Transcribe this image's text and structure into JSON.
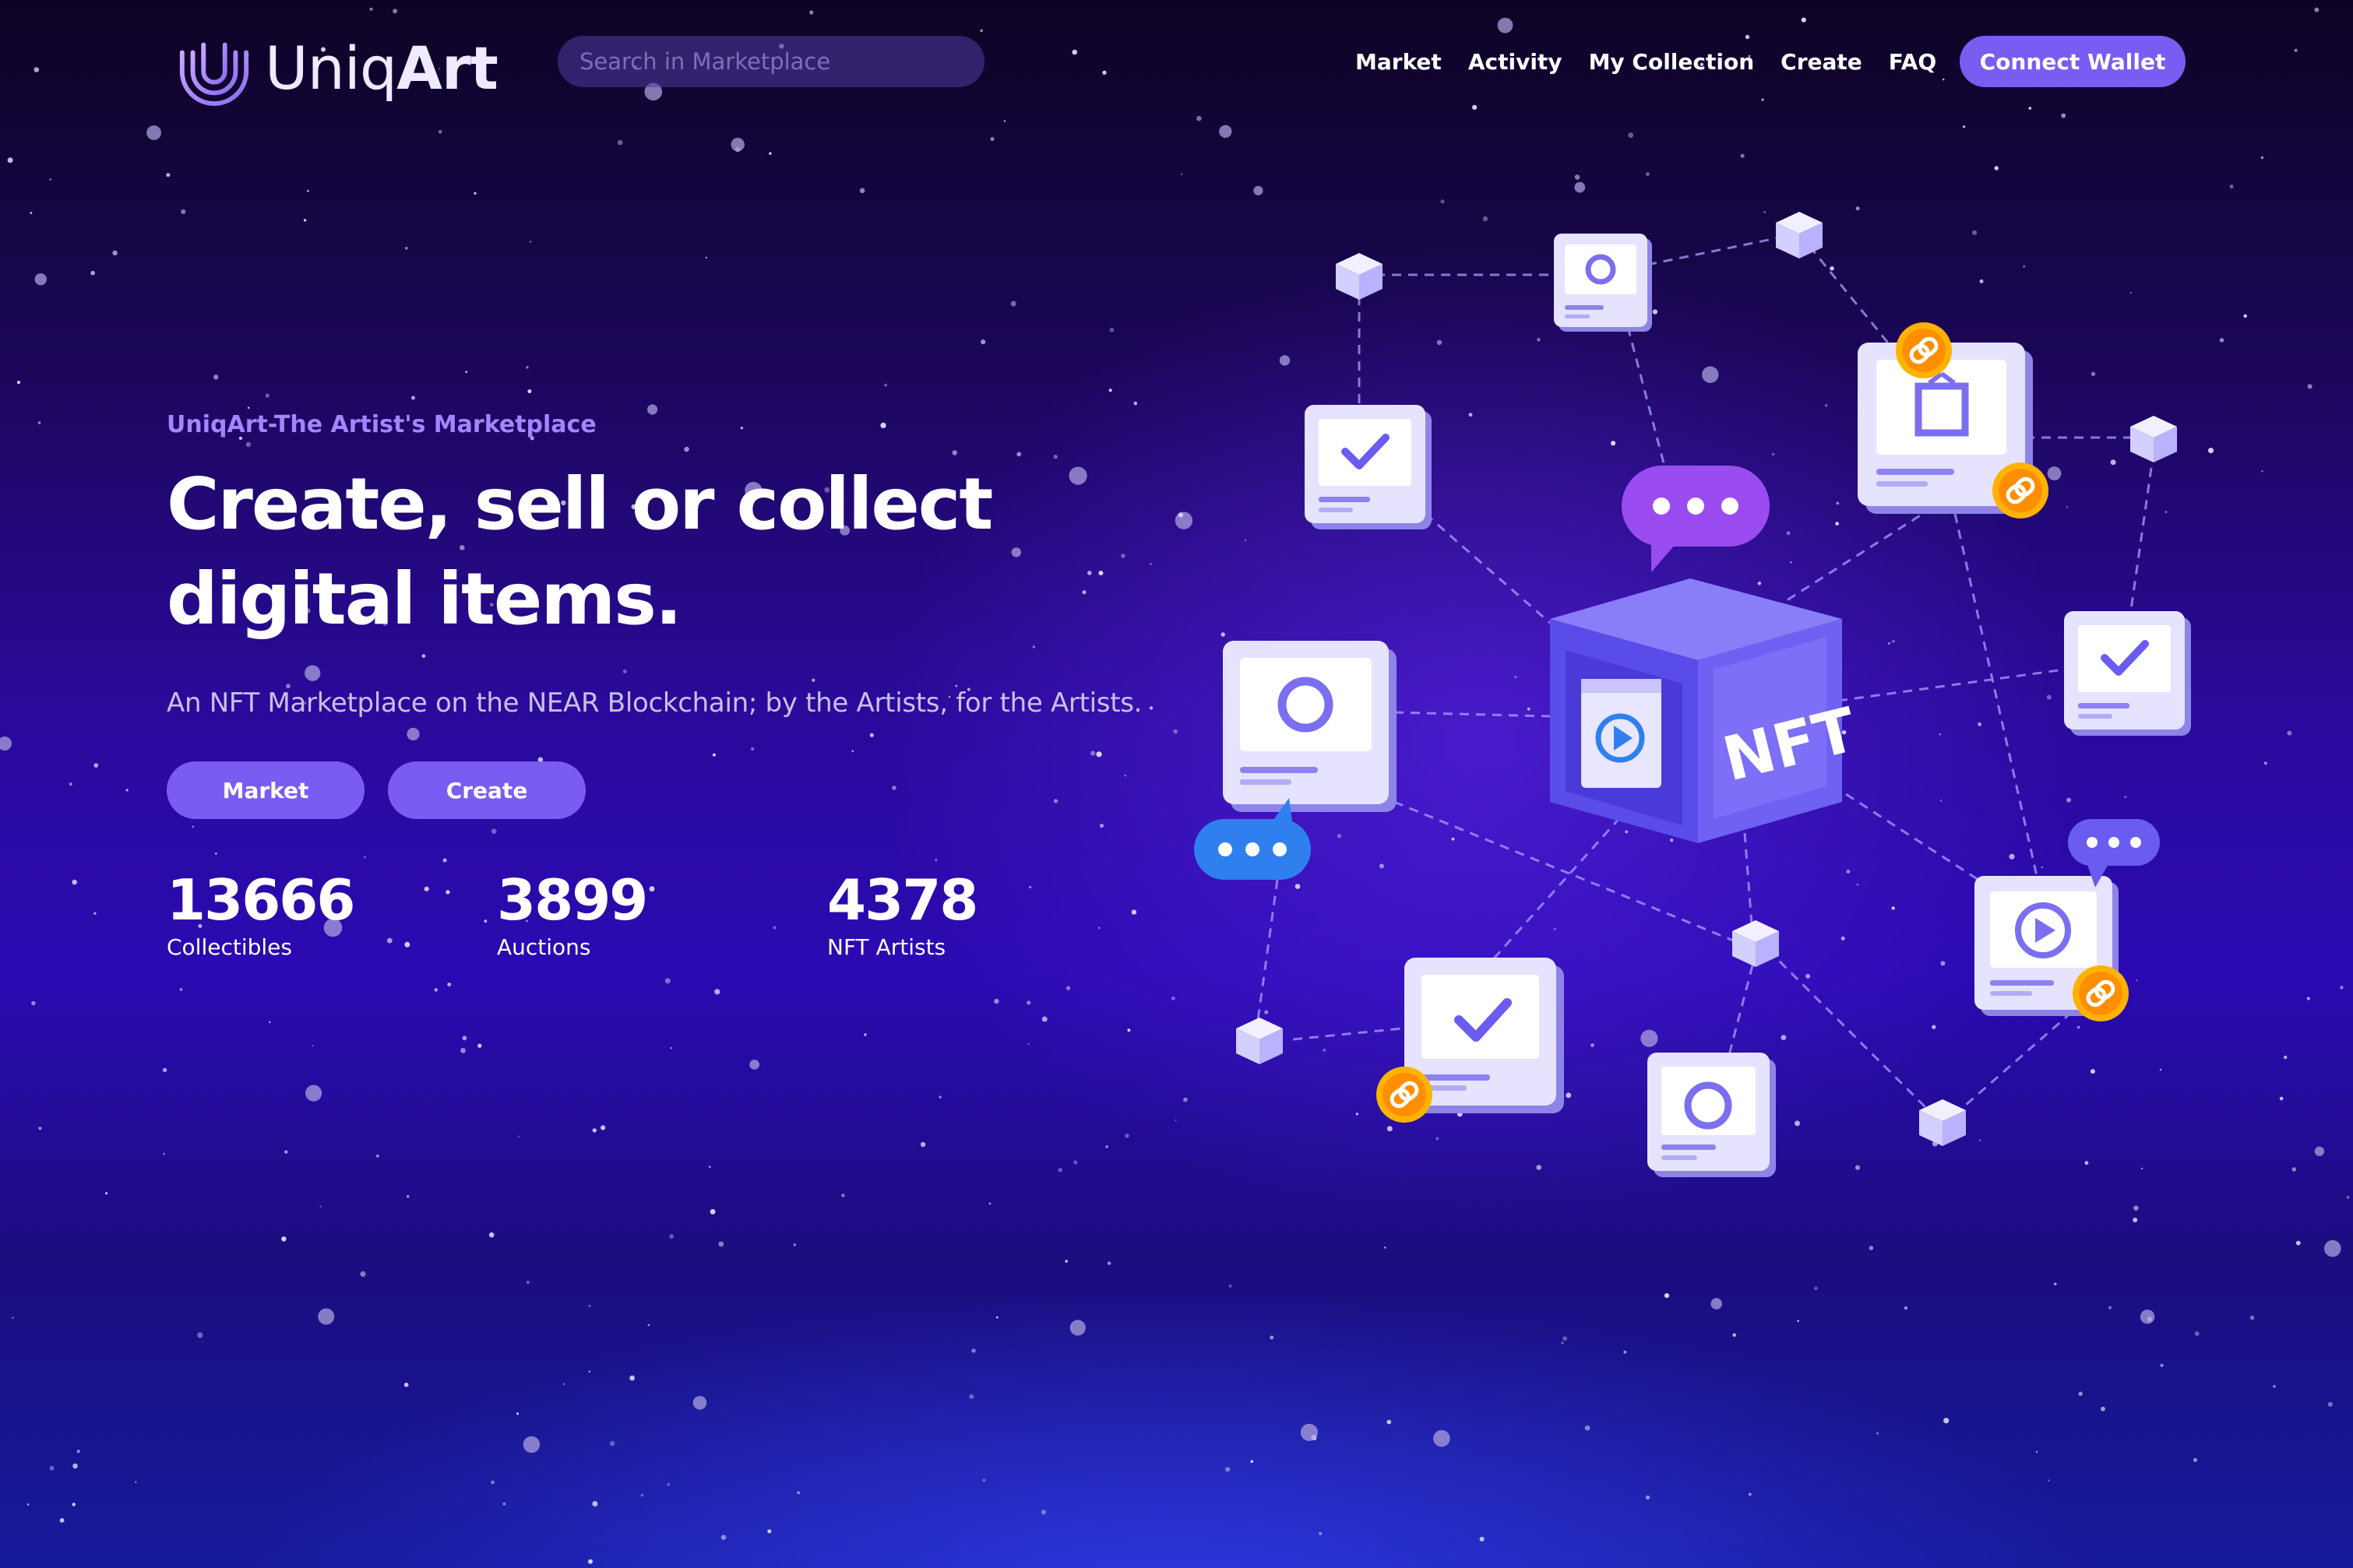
{
  "header": {
    "logo_part1": "Uniq",
    "logo_part2": "Art",
    "search_placeholder": "Search in Marketplace",
    "nav": [
      "Market",
      "Activity",
      "My Collection",
      "Create",
      "FAQ"
    ],
    "connect_label": "Connect Wallet"
  },
  "hero": {
    "eyebrow": "UniqArt-The Artist's Marketplace",
    "headline_line1": "Create, sell or collect",
    "headline_line2": "digital items.",
    "subtitle": "An NFT Marketplace on the NEAR Blockchain; by the Artists, for the Artists.",
    "buttons": {
      "market": "Market",
      "create": "Create"
    },
    "stats": [
      {
        "value": "13666",
        "label": "Collectibles"
      },
      {
        "value": "3899",
        "label": "Auctions"
      },
      {
        "value": "4378",
        "label": "NFT Artists"
      }
    ]
  },
  "illustration": {
    "cube_label": "NFT",
    "colors": {
      "accent": "#7b5cf2",
      "eyebrow": "#a186ff",
      "cube": "#6a5cf0",
      "card": "#dcd8ff",
      "coin": "#ffa000",
      "bubble_blue": "#2f7fef",
      "bubble_purple": "#9a4cf0"
    }
  }
}
